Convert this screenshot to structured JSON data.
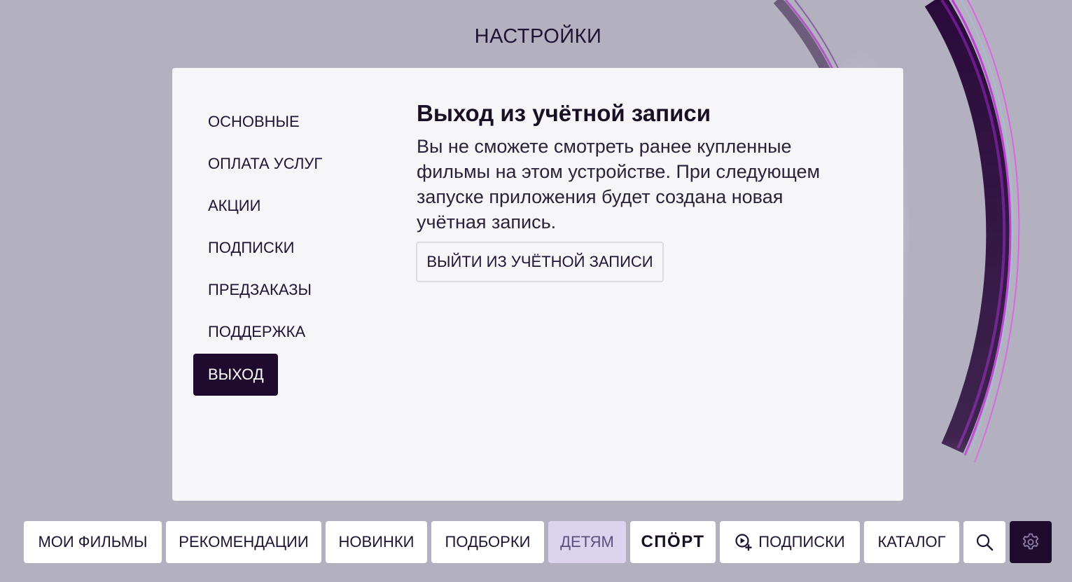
{
  "page": {
    "title": "НАСТРОЙКИ"
  },
  "sidebar": {
    "items": [
      {
        "label": "ОСНОВНЫЕ"
      },
      {
        "label": "ОПЛАТА УСЛУГ"
      },
      {
        "label": "АКЦИИ"
      },
      {
        "label": "ПОДПИСКИ"
      },
      {
        "label": "ПРЕДЗАКАЗЫ"
      },
      {
        "label": "ПОДДЕРЖКА"
      },
      {
        "label": "ВЫХОД",
        "active": true
      }
    ]
  },
  "content": {
    "title": "Выход из учётной записи",
    "description": "Вы не сможете смотреть ранее купленные фильмы на этом устройстве. При следующем запуске приложения будет создана новая учётная запись.",
    "logout_button": "ВЫЙТИ ИЗ УЧЁТНОЙ ЗАПИСИ"
  },
  "bottom_nav": {
    "items": [
      {
        "label": "МОИ ФИЛЬМЫ"
      },
      {
        "label": "РЕКОМЕНДАЦИИ"
      },
      {
        "label": "НОВИНКИ"
      },
      {
        "label": "ПОДБОРКИ"
      },
      {
        "label": "ДЕТЯМ"
      },
      {
        "label": "СПӦРТ"
      },
      {
        "label": "ПОДПИСКИ",
        "icon": "play-plus-icon"
      },
      {
        "label": "КАТАЛОГ"
      }
    ],
    "search_icon": "search-icon",
    "settings_icon": "gear-icon"
  },
  "colors": {
    "background": "#b3b0c0",
    "panel": "#f6f6f9",
    "accent_dark": "#1f0b2e",
    "text": "#1f1433",
    "kids_tab": "#dcd4ef"
  }
}
